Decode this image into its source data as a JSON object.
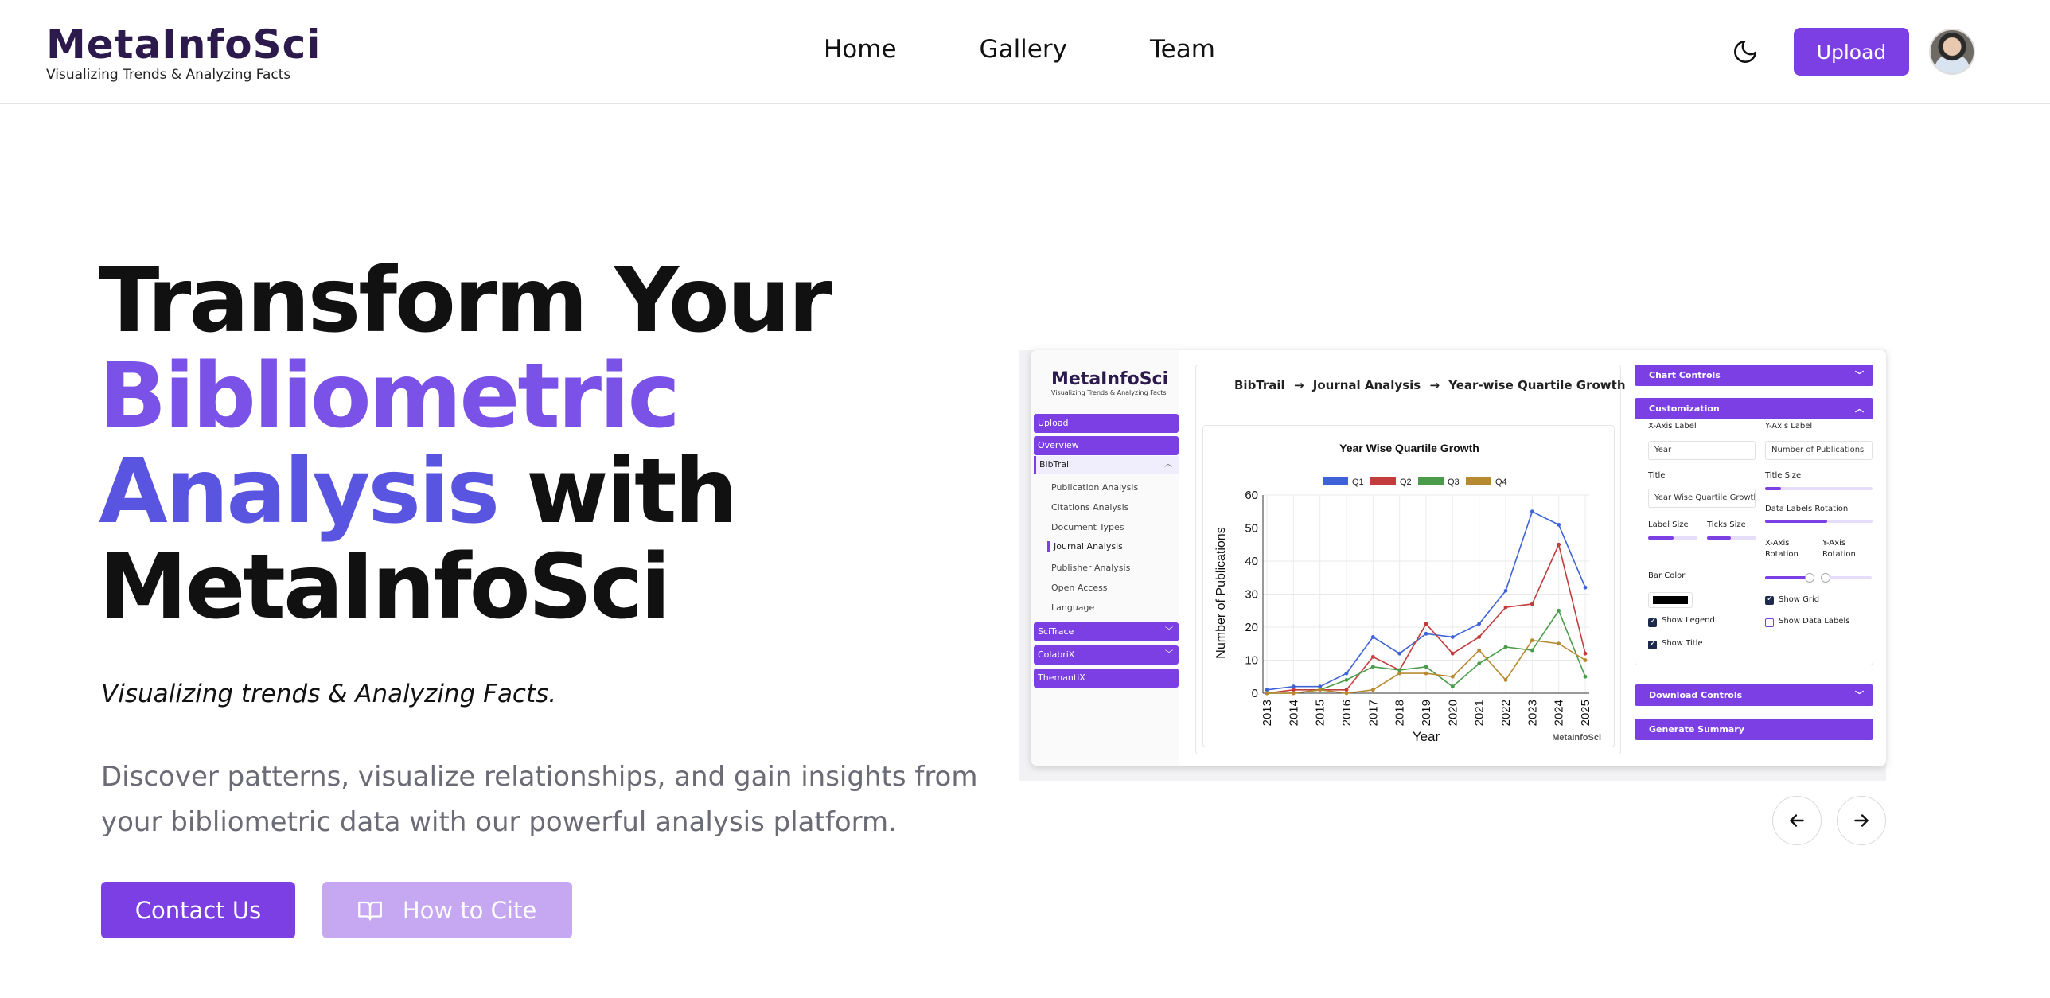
{
  "header": {
    "logo_title": "MetaInfoSci",
    "logo_tagline": "Visualizing Trends & Analyzing Facts",
    "nav": [
      "Home",
      "Gallery",
      "Team"
    ],
    "upload_label": "Upload",
    "theme_icon": "moon-icon",
    "avatar_icon": "user-avatar"
  },
  "hero": {
    "title_line1": "Transform Your",
    "title_line2": "Bibliometric",
    "title_line3a": "Analysis",
    "title_line3b": "with",
    "title_line4": "MetaInfoSci",
    "tagline": "Visualizing trends & Analyzing Facts.",
    "description": "Discover patterns, visualize relationships, and gain insights from your bibliometric data with our powerful analysis platform.",
    "contact_label": "Contact Us",
    "cite_label": "How to Cite",
    "cite_icon": "book-icon"
  },
  "preview": {
    "sidebar_logo_title": "MetaInfoSci",
    "sidebar_logo_tagline": "Visualizing Trends & Analyzing Facts",
    "sidebar_top": [
      "Upload",
      "Overview"
    ],
    "group_label": "BibTrail",
    "group_items": [
      "Publication Analysis",
      "Citations Analysis",
      "Document Types",
      "Journal Analysis",
      "Publisher Analysis",
      "Open Access",
      "Language"
    ],
    "active_item": "Journal Analysis",
    "sidebar_bottom": [
      "SciTrace",
      "ColabriX",
      "ThemantiX"
    ],
    "breadcrumb": [
      "BibTrail",
      "Journal Analysis",
      "Year-wise Quartile Growth"
    ],
    "breadcrumb_sep": "→",
    "watermark": "MetaInfoSci",
    "controls": {
      "chart_controls": "Chart Controls",
      "customization": "Customization",
      "x_axis_label": "X-Axis Label",
      "x_axis_value": "Year",
      "y_axis_label": "Y-Axis Label",
      "y_axis_value": "Number of Publications",
      "title_label": "Title",
      "title_value": "Year Wise Quartile Growth",
      "title_size": "Title Size",
      "label_size": "Label Size",
      "ticks_size": "Ticks Size",
      "data_labels_rotation": "Data Labels Rotation",
      "bar_color": "Bar Color",
      "bar_color_value": "#000000",
      "x_axis_rotation_l1": "X-Axis",
      "x_axis_rotation_l2": "Rotation",
      "y_axis_rotation_l1": "Y-Axis",
      "y_axis_rotation_l2": "Rotation",
      "show_grid": "Show Grid",
      "show_legend": "Show Legend",
      "show_data_labels": "Show Data Labels",
      "show_title": "Show Title",
      "show_grid_checked": true,
      "show_legend_checked": true,
      "show_data_labels_checked": false,
      "show_title_checked": true,
      "download_controls": "Download Controls",
      "generate_summary": "Generate Summary"
    }
  },
  "carousel": {
    "prev_icon": "arrow-left-icon",
    "next_icon": "arrow-right-icon"
  },
  "chart_data": {
    "type": "line",
    "title": "Year Wise Quartile Growth",
    "xlabel": "Year",
    "ylabel": "Number of Publications",
    "x": [
      "2013",
      "2014",
      "2015",
      "2016",
      "2017",
      "2018",
      "2019",
      "2020",
      "2021",
      "2022",
      "2023",
      "2024",
      "2025"
    ],
    "ylim": [
      0,
      60
    ],
    "yticks": [
      "0",
      "10",
      "20",
      "30",
      "40",
      "50",
      "60"
    ],
    "grid": true,
    "legend_position": "top",
    "series": [
      {
        "name": "Q1",
        "color": "#3d63d6",
        "values": [
          1,
          2,
          2,
          6,
          17,
          12,
          18,
          17,
          21,
          31,
          55,
          51,
          32
        ]
      },
      {
        "name": "Q2",
        "color": "#c43d3d",
        "values": [
          0,
          1,
          1,
          1,
          11,
          7,
          21,
          12,
          17,
          26,
          27,
          45,
          12
        ]
      },
      {
        "name": "Q3",
        "color": "#4a9c4a",
        "values": [
          0,
          0,
          1,
          4,
          8,
          7,
          8,
          2,
          9,
          14,
          13,
          25,
          5
        ]
      },
      {
        "name": "Q4",
        "color": "#b88a30",
        "values": [
          0,
          0,
          1,
          0,
          1,
          6,
          6,
          5,
          13,
          4,
          16,
          15,
          10
        ]
      }
    ]
  }
}
